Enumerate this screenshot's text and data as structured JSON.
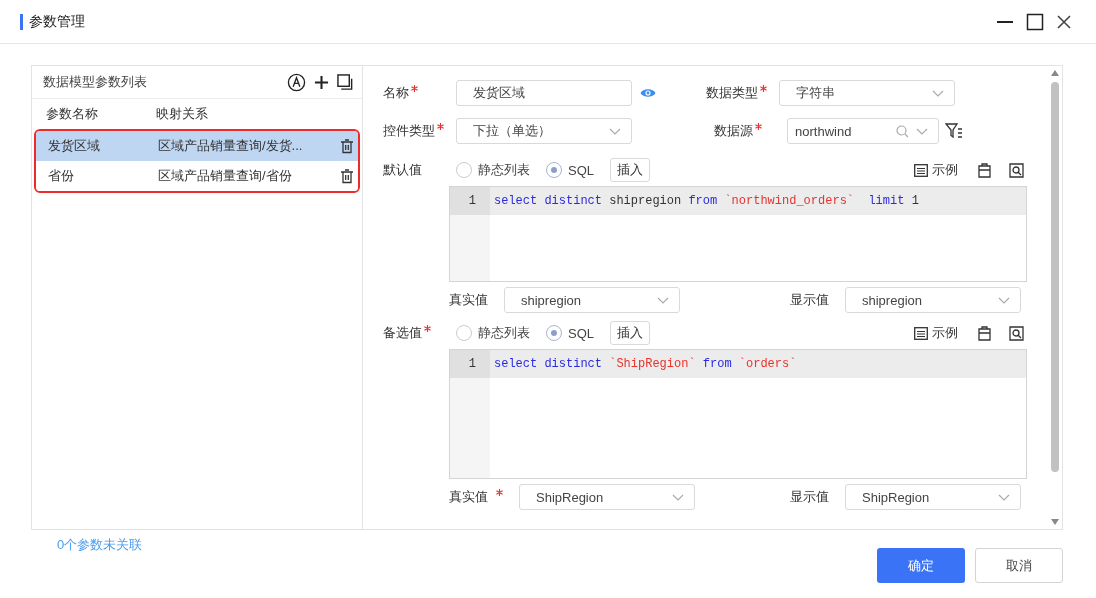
{
  "window": {
    "title": "参数管理"
  },
  "param_list": {
    "title": "数据模型参数列表",
    "columns": [
      "参数名称",
      "映射关系"
    ],
    "rows": [
      {
        "name": "发货区域",
        "mapping": "区域产品销量查询/发货...",
        "selected": true
      },
      {
        "name": "省份",
        "mapping": "区域产品销量查询/省份",
        "selected": false
      }
    ]
  },
  "unlinked_note": "0个参数未关联",
  "form": {
    "name": {
      "label": "名称",
      "required": true,
      "value": "发货区域"
    },
    "data_type": {
      "label": "数据类型",
      "required": true,
      "value": "字符串"
    },
    "control_type": {
      "label": "控件类型",
      "required": true,
      "value": "下拉（单选）"
    },
    "datasource": {
      "label": "数据源",
      "required": true,
      "value": "northwind"
    },
    "sections": [
      {
        "label": "默认值",
        "required": false,
        "options": [
          {
            "label": "静态列表",
            "selected": false
          },
          {
            "label": "SQL",
            "selected": true
          }
        ],
        "insert_button": "插入",
        "example_button": "示例",
        "line_number": "1",
        "code": [
          {
            "kind": "keyword",
            "text": "select"
          },
          {
            "kind": "keyword",
            "text": "distinct"
          },
          {
            "kind": "plain",
            "text": "shipregion"
          },
          {
            "kind": "keyword",
            "text": "from"
          },
          {
            "kind": "string",
            "text": "`northwind_orders`"
          },
          {
            "kind": "keyword",
            "text": " limit"
          },
          {
            "kind": "plain",
            "text": "1"
          }
        ],
        "real_value": {
          "label": "真实值",
          "required": false,
          "value": "shipregion"
        },
        "display_value": {
          "label": "显示值",
          "value": "shipregion"
        }
      },
      {
        "label": "备选值",
        "required": true,
        "options": [
          {
            "label": "静态列表",
            "selected": false
          },
          {
            "label": "SQL",
            "selected": true
          }
        ],
        "insert_button": "插入",
        "example_button": "示例",
        "line_number": "1",
        "code": [
          {
            "kind": "keyword",
            "text": "select"
          },
          {
            "kind": "keyword",
            "text": "distinct"
          },
          {
            "kind": "string",
            "text": "`ShipRegion`"
          },
          {
            "kind": "keyword",
            "text": "from"
          },
          {
            "kind": "string",
            "text": "`orders`"
          }
        ],
        "real_value": {
          "label": "真实值",
          "required": true,
          "value": "ShipRegion"
        },
        "display_value": {
          "label": "显示值",
          "value": "ShipRegion"
        }
      }
    ]
  },
  "buttons": {
    "confirm": "确定",
    "cancel": "取消"
  }
}
